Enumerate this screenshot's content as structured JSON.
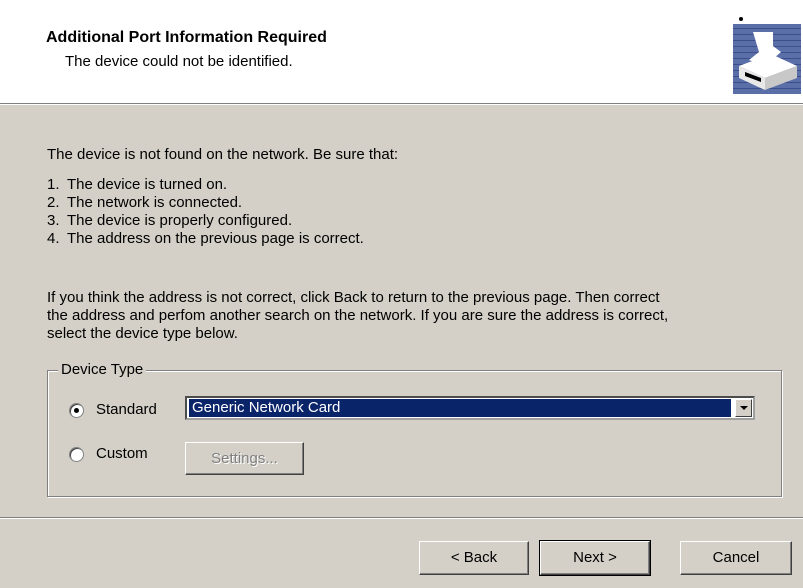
{
  "header": {
    "title": "Additional Port Information Required",
    "subtitle": "The device could not be identified.",
    "icon": "printer-network-icon"
  },
  "intro": "The device is not found on the network.  Be sure that:",
  "checklist": [
    {
      "num": "1.",
      "text": "The device is turned on."
    },
    {
      "num": "2.",
      "text": "The network is connected."
    },
    {
      "num": "3.",
      "text": "The device is properly configured."
    },
    {
      "num": "4.",
      "text": "The address on the previous page is correct."
    }
  ],
  "instructions": [
    "If you think the address is not correct, click Back to return to the previous page.  Then correct",
    "the address and perfom another search on the network.  If you are sure the address is correct,",
    "select the device type below."
  ],
  "device_type": {
    "legend": "Device Type",
    "standard_label": "Standard",
    "custom_label": "Custom",
    "selected": "Standard",
    "dropdown_value": "Generic Network Card",
    "settings_label": "Settings..."
  },
  "buttons": {
    "back": "< Back",
    "next": "Next >",
    "cancel": "Cancel"
  },
  "colors": {
    "dialog_bg": "#d4d0c8",
    "selection": "#0a246a"
  }
}
